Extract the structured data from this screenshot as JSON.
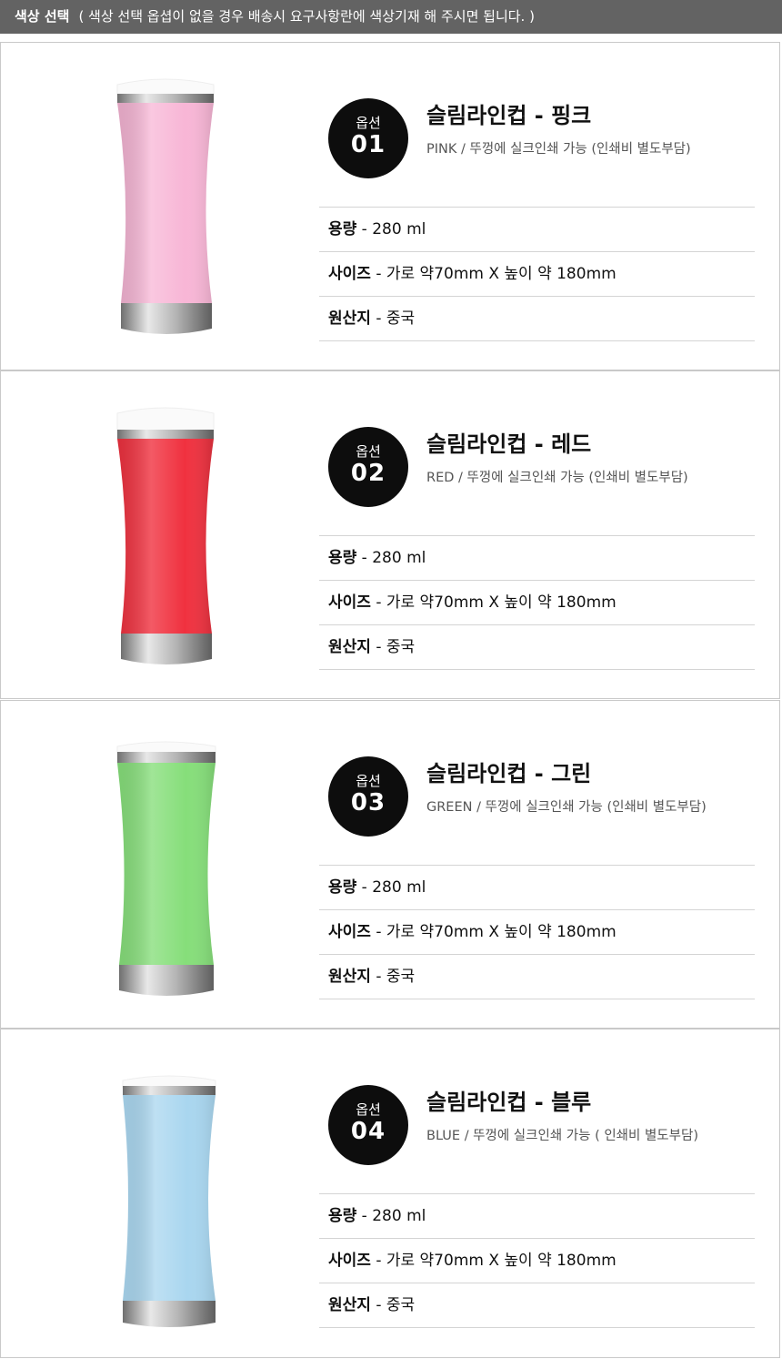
{
  "header": {
    "title": "색상 선택",
    "note": "( 색상 선택 옵셥이 없을 경우 배송시 요구사항란에 색상기재 해 주시면 됩니다. )"
  },
  "options": [
    {
      "badge_label": "옵션",
      "badge_number": "01",
      "title": "슬림라인컵 - 핑크",
      "subtitle": "PINK / 뚜껑에 실크인쇄 가능 (인쇄비 별도부담)",
      "cup_color": "#f8b6d6",
      "specs": [
        {
          "key": "용량",
          "value": " - 280 ml"
        },
        {
          "key": "사이즈",
          "value": " - 가로 약70mm X 높이 약 180mm"
        },
        {
          "key": "원산지",
          "value": " - 중국"
        }
      ]
    },
    {
      "badge_label": "옵션",
      "badge_number": "02",
      "title": "슬림라인컵 - 레드",
      "subtitle": "RED / 뚜껑에 실크인쇄 가능 (인쇄비 별도부담)",
      "cup_color": "#f0313f",
      "specs": [
        {
          "key": "용량",
          "value": " - 280 ml"
        },
        {
          "key": "사이즈",
          "value": " - 가로 약70mm X 높이 약 180mm"
        },
        {
          "key": "원산지",
          "value": " - 중국"
        }
      ]
    },
    {
      "badge_label": "옵션",
      "badge_number": "03",
      "title": "슬림라인컵 - 그린",
      "subtitle": "GREEN / 뚜껑에 실크인쇄 가능 (인쇄비 별도부담)",
      "cup_color": "#86de7a",
      "specs": [
        {
          "key": "용량",
          "value": " - 280 ml"
        },
        {
          "key": "사이즈",
          "value": " - 가로 약70mm X 높이 약 180mm"
        },
        {
          "key": "원산지",
          "value": " - 중국"
        }
      ]
    },
    {
      "badge_label": "옵션",
      "badge_number": "04",
      "title": "슬림라인컵 - 블루",
      "subtitle": "BLUE / 뚜껑에 실크인쇄 가능 ( 인쇄비 별도부담)",
      "cup_color": "#a9d6ef",
      "specs": [
        {
          "key": "용량",
          "value": " - 280 ml"
        },
        {
          "key": "사이즈",
          "value": " - 가로 약70mm X 높이 약 180mm"
        },
        {
          "key": "원산지",
          "value": " - 중국"
        }
      ]
    }
  ]
}
